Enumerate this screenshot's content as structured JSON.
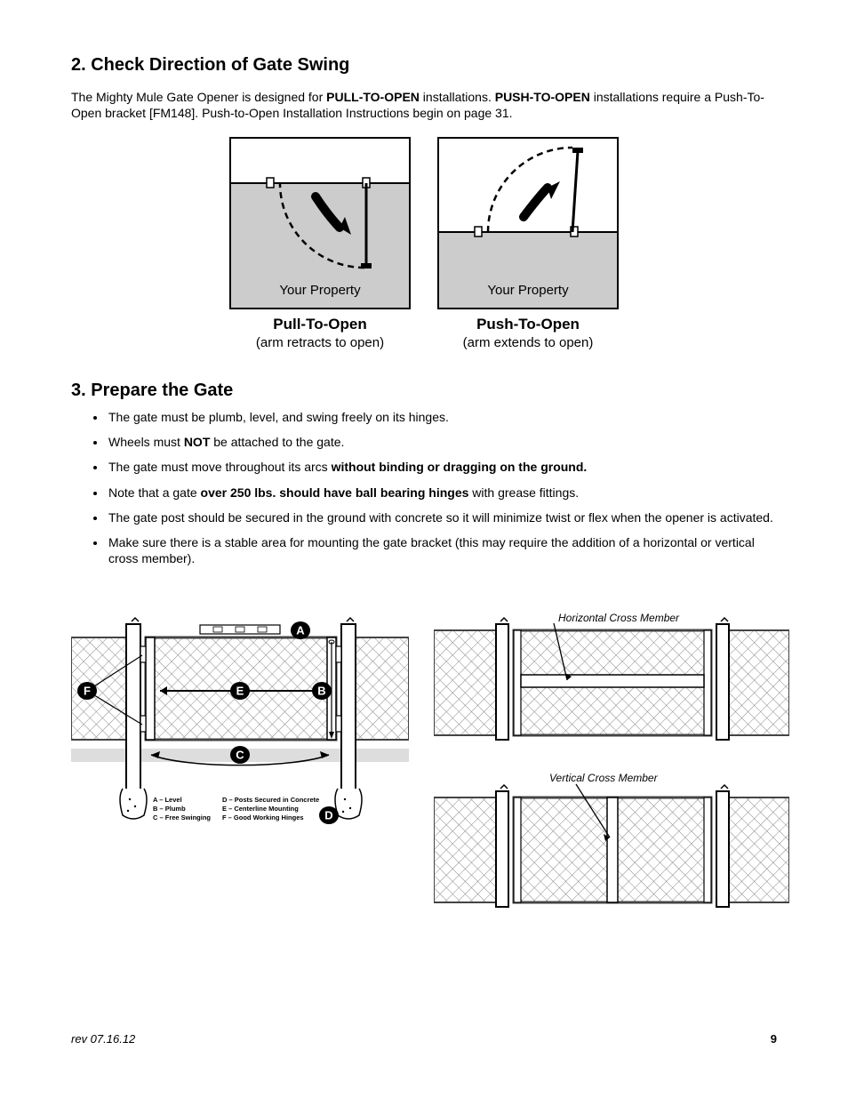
{
  "section2": {
    "title": "2. Check Direction of Gate Swing",
    "intro_pre": "The Mighty Mule Gate Opener is designed for ",
    "intro_b1": "PULL-TO-OPEN",
    "intro_mid1": " installations. ",
    "intro_b2": "PUSH-TO-OPEN",
    "intro_mid2": " installations require a Push-To-Open bracket [FM148]. Push-to-Open Installation Instructions begin on page 31.",
    "property_label": "Your Property",
    "pull_title": "Pull-To-Open",
    "pull_sub": "(arm retracts to open)",
    "push_title": "Push-To-Open",
    "push_sub": "(arm extends to open)"
  },
  "section3": {
    "title": "3. Prepare the Gate",
    "bullets": [
      {
        "pre": "The gate must be plumb, level, and swing freely on its hinges.",
        "b": "",
        "post": ""
      },
      {
        "pre": "Wheels must ",
        "b": "NOT",
        "post": " be attached to the gate."
      },
      {
        "pre": "The gate must move throughout its arcs ",
        "b": "without binding or dragging on the ground.",
        "post": ""
      },
      {
        "pre": "Note that a gate ",
        "b": "over 250 lbs. should have ball bearing hinges",
        "post": " with grease fittings."
      },
      {
        "pre": "The gate post should be secured in the ground with concrete so it will minimize twist or flex when the opener is activated.",
        "b": "",
        "post": ""
      },
      {
        "pre": "Make sure there is a stable area for mounting the gate bracket (this may require the addition of a horizontal or vertical cross member).",
        "b": "",
        "post": ""
      }
    ]
  },
  "leftDiagram": {
    "legend": {
      "A": "A – Level",
      "B": "B – Plumb",
      "C": "C – Free Swinging",
      "D": "D – Posts Secured in Concrete",
      "E": "E – Centerline Mounting",
      "F": "F – Good Working Hinges"
    },
    "badges": [
      "A",
      "B",
      "C",
      "D",
      "E",
      "F"
    ]
  },
  "rightDiagram": {
    "horiz_label": "Horizontal Cross Member",
    "vert_label": "Vertical Cross Member"
  },
  "footer": {
    "rev": "rev 07.16.12",
    "page": "9"
  }
}
